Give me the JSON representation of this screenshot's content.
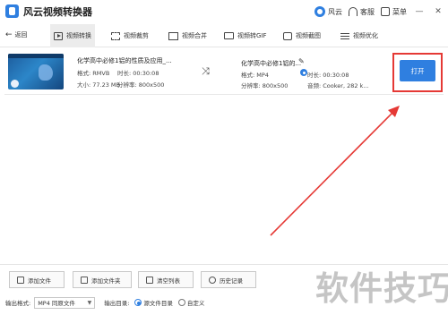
{
  "window": {
    "title": "风云视频转换器",
    "right": {
      "brand": "风云",
      "support": "客服",
      "menu": "菜单",
      "minimize": "—",
      "close": "✕"
    }
  },
  "toolbar": {
    "back": "返回",
    "tabs": [
      {
        "label": "视频转换",
        "icon": "play-icon",
        "active": true
      },
      {
        "label": "视频裁剪",
        "icon": "crop-icon",
        "active": false
      },
      {
        "label": "视频合并",
        "icon": "merge-icon",
        "active": false
      },
      {
        "label": "视频转GIF",
        "icon": "gif-icon",
        "active": false
      },
      {
        "label": "视频截图",
        "icon": "screenshot-icon",
        "active": false
      },
      {
        "label": "视频优化",
        "icon": "tune-icon",
        "active": false
      }
    ]
  },
  "file": {
    "source": {
      "name": "化学高中必修1铝的性质及应用_...",
      "format": "格式: RMVB",
      "duration": "时长: 00:30:08",
      "size": "大小: 77.23 MB",
      "resolution": "分辨率: 800x500"
    },
    "output": {
      "name": "化学高中必修1铝的...",
      "format": "格式: MP4",
      "duration": "时长: 00:30:08",
      "resolution": "分辨率: 800x500",
      "audio": "音频: Cooker, 282 k..."
    },
    "open_label": "打开"
  },
  "bottom": {
    "buttons": [
      "添加文件",
      "添加文件夹",
      "清空列表",
      "历史记录"
    ],
    "output_format_label": "输出格式:",
    "output_format_value": "MP4 同原文件",
    "output_dir_label": "输出目录:",
    "dir_options": [
      {
        "label": "源文件目录",
        "selected": true
      },
      {
        "label": "自定义",
        "selected": false
      }
    ]
  },
  "watermark": "软件技巧",
  "colors": {
    "accent": "#2f7fe0",
    "annotation": "#e53935"
  }
}
